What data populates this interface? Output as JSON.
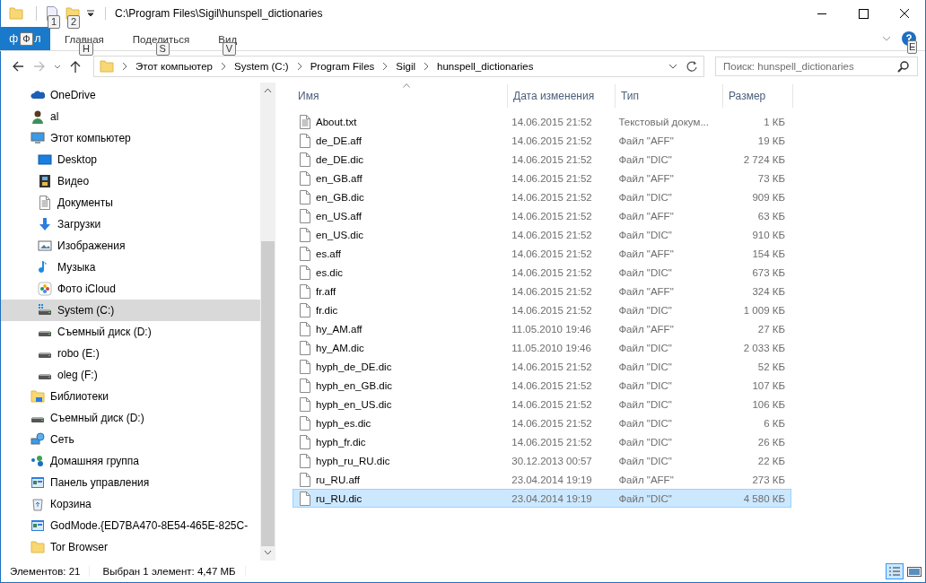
{
  "window": {
    "title": "C:\\Program Files\\Sigil\\hunspell_dictionaries",
    "quick_access_keytips": [
      "1",
      "2"
    ]
  },
  "ribbon": {
    "file_tab": {
      "left": "ф",
      "keytip": "Ф",
      "right": "л"
    },
    "tabs": [
      {
        "label": "Главная",
        "keytip": "H",
        "selected": false
      },
      {
        "label": "Поделиться",
        "keytip": "S",
        "selected": false
      },
      {
        "label": "Вид",
        "keytip": "V",
        "selected": false
      }
    ],
    "help_keytip": "E"
  },
  "address": {
    "crumbs": [
      "Этот компьютер",
      "System (C:)",
      "Program Files",
      "Sigil",
      "hunspell_dictionaries"
    ],
    "search_placeholder": "Поиск: hunspell_dictionaries"
  },
  "sidebar": {
    "items": [
      {
        "label": "OneDrive",
        "selected": false
      },
      {
        "label": "al",
        "selected": false
      },
      {
        "label": "Этот компьютер",
        "selected": false,
        "children": [
          {
            "label": "Desktop",
            "selected": false
          },
          {
            "label": "Видео",
            "selected": false
          },
          {
            "label": "Документы",
            "selected": false
          },
          {
            "label": "Загрузки",
            "selected": false
          },
          {
            "label": "Изображения",
            "selected": false
          },
          {
            "label": "Музыка",
            "selected": false
          },
          {
            "label": "Фото iCloud",
            "selected": false
          },
          {
            "label": "System (C:)",
            "selected": true
          },
          {
            "label": "Съемный диск (D:)",
            "selected": false
          },
          {
            "label": "robo (E:)",
            "selected": false
          },
          {
            "label": "oleg (F:)",
            "selected": false
          }
        ]
      },
      {
        "label": "Библиотеки",
        "selected": false
      },
      {
        "label": "Съемный диск (D:)",
        "selected": false
      },
      {
        "label": "Сеть",
        "selected": false
      },
      {
        "label": "Домашняя группа",
        "selected": false
      },
      {
        "label": "Панель управления",
        "selected": false
      },
      {
        "label": "Корзина",
        "selected": false
      },
      {
        "label": "GodMode.{ED7BA470-8E54-465E-825C-",
        "selected": false
      },
      {
        "label": "Tor Browser",
        "selected": false
      }
    ]
  },
  "table": {
    "columns": [
      "Имя",
      "Дата изменения",
      "Тип",
      "Размер"
    ],
    "rows": [
      {
        "kind": "text",
        "name": "About.txt",
        "date": "14.06.2015 21:52",
        "type": "Текстовый докум...",
        "size": "1 КБ",
        "selected": false
      },
      {
        "kind": "file",
        "name": "de_DE.aff",
        "date": "14.06.2015 21:52",
        "type": "Файл \"AFF\"",
        "size": "19 КБ",
        "selected": false
      },
      {
        "kind": "file",
        "name": "de_DE.dic",
        "date": "14.06.2015 21:52",
        "type": "Файл \"DIC\"",
        "size": "2 724 КБ",
        "selected": false
      },
      {
        "kind": "file",
        "name": "en_GB.aff",
        "date": "14.06.2015 21:52",
        "type": "Файл \"AFF\"",
        "size": "73 КБ",
        "selected": false
      },
      {
        "kind": "file",
        "name": "en_GB.dic",
        "date": "14.06.2015 21:52",
        "type": "Файл \"DIC\"",
        "size": "909 КБ",
        "selected": false
      },
      {
        "kind": "file",
        "name": "en_US.aff",
        "date": "14.06.2015 21:52",
        "type": "Файл \"AFF\"",
        "size": "63 КБ",
        "selected": false
      },
      {
        "kind": "file",
        "name": "en_US.dic",
        "date": "14.06.2015 21:52",
        "type": "Файл \"DIC\"",
        "size": "910 КБ",
        "selected": false
      },
      {
        "kind": "file",
        "name": "es.aff",
        "date": "14.06.2015 21:52",
        "type": "Файл \"AFF\"",
        "size": "154 КБ",
        "selected": false
      },
      {
        "kind": "file",
        "name": "es.dic",
        "date": "14.06.2015 21:52",
        "type": "Файл \"DIC\"",
        "size": "673 КБ",
        "selected": false
      },
      {
        "kind": "file",
        "name": "fr.aff",
        "date": "14.06.2015 21:52",
        "type": "Файл \"AFF\"",
        "size": "324 КБ",
        "selected": false
      },
      {
        "kind": "file",
        "name": "fr.dic",
        "date": "14.06.2015 21:52",
        "type": "Файл \"DIC\"",
        "size": "1 009 КБ",
        "selected": false
      },
      {
        "kind": "file",
        "name": "hy_AM.aff",
        "date": "11.05.2010 19:46",
        "type": "Файл \"AFF\"",
        "size": "27 КБ",
        "selected": false
      },
      {
        "kind": "file",
        "name": "hy_AM.dic",
        "date": "11.05.2010 19:46",
        "type": "Файл \"DIC\"",
        "size": "2 033 КБ",
        "selected": false
      },
      {
        "kind": "file",
        "name": "hyph_de_DE.dic",
        "date": "14.06.2015 21:52",
        "type": "Файл \"DIC\"",
        "size": "52 КБ",
        "selected": false
      },
      {
        "kind": "file",
        "name": "hyph_en_GB.dic",
        "date": "14.06.2015 21:52",
        "type": "Файл \"DIC\"",
        "size": "107 КБ",
        "selected": false
      },
      {
        "kind": "file",
        "name": "hyph_en_US.dic",
        "date": "14.06.2015 21:52",
        "type": "Файл \"DIC\"",
        "size": "106 КБ",
        "selected": false
      },
      {
        "kind": "file",
        "name": "hyph_es.dic",
        "date": "14.06.2015 21:52",
        "type": "Файл \"DIC\"",
        "size": "6 КБ",
        "selected": false
      },
      {
        "kind": "file",
        "name": "hyph_fr.dic",
        "date": "14.06.2015 21:52",
        "type": "Файл \"DIC\"",
        "size": "26 КБ",
        "selected": false
      },
      {
        "kind": "file",
        "name": "hyph_ru_RU.dic",
        "date": "30.12.2013 00:57",
        "type": "Файл \"DIC\"",
        "size": "22 КБ",
        "selected": false
      },
      {
        "kind": "file",
        "name": "ru_RU.aff",
        "date": "23.04.2014 19:19",
        "type": "Файл \"AFF\"",
        "size": "273 КБ",
        "selected": false
      },
      {
        "kind": "file",
        "name": "ru_RU.dic",
        "date": "23.04.2014 19:19",
        "type": "Файл \"DIC\"",
        "size": "4 580 КБ",
        "selected": true
      }
    ]
  },
  "status_bar": {
    "count": "Элементов: 21",
    "selection": "Выбран 1 элемент: 4,47 МБ"
  }
}
